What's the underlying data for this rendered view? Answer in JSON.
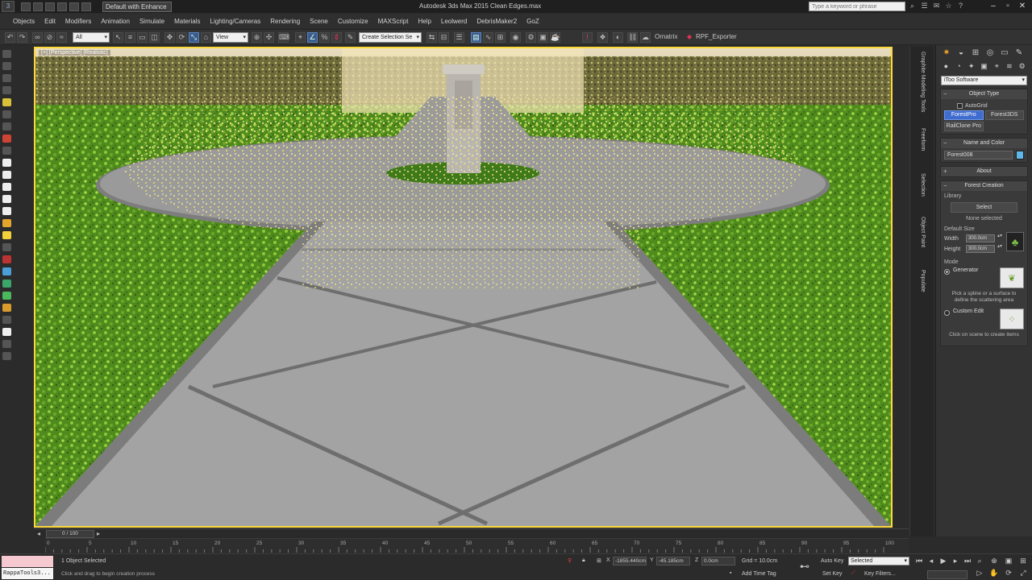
{
  "titlebar": {
    "app_button": "3",
    "workspace": "Default with Enhance",
    "title": "Autodesk 3ds Max 2015    Clean Edges.max",
    "search_placeholder": "Type a keyword or phrase"
  },
  "menu": [
    "Objects",
    "Edit",
    "Modifiers",
    "Animation",
    "Simulate",
    "Materials",
    "Lighting/Cameras",
    "Rendering",
    "Scene",
    "Customize",
    "MAXScript",
    "Help",
    "Leolwerd",
    "DebrisMaker2",
    "GoZ"
  ],
  "toolbar": {
    "selection_filter": "All",
    "ref_coord": "View",
    "named_selection": "Create Selection Se",
    "buttons": [
      "Ornatrix",
      "RPF_Exporter"
    ]
  },
  "viewport": {
    "label": "[+] [Perspective] [Realistic]",
    "border_color": "#fcd93a"
  },
  "tabs": [
    "Graphite Modeling Tools",
    "Freeform",
    "Selection",
    "Object Paint",
    "Populate"
  ],
  "command_panel": {
    "category": "iToo Software",
    "object_type": {
      "title": "Object Type",
      "autogrid": "AutoGrid",
      "buttons": [
        "ForestPro",
        "Forest3DS",
        "RailClone Pro"
      ],
      "active": "ForestPro"
    },
    "name_color": {
      "title": "Name and Color",
      "name": "Forest008",
      "color": "#5fb6e8"
    },
    "about": "About",
    "forest_creation": {
      "title": "Forest Creation",
      "library_label": "Library",
      "select_button": "Select",
      "none_selected": "None selected",
      "default_size": "Default Size",
      "width_label": "Width",
      "width_value": "300.0cm",
      "height_label": "Height",
      "height_value": "300.0cm",
      "mode_label": "Mode",
      "generator": "Generator",
      "generator_desc": "Pick a spline or a surface to define the scattering area",
      "custom_edit": "Custom Edit",
      "custom_desc": "Click on scene to create items"
    }
  },
  "timeline": {
    "slider": "0 / 100",
    "ticks": [
      "0",
      "5",
      "10",
      "15",
      "20",
      "25",
      "30",
      "35",
      "40",
      "45",
      "50",
      "55",
      "60",
      "65",
      "70",
      "75",
      "80",
      "85",
      "90",
      "95",
      "100"
    ]
  },
  "status": {
    "maxscript": "RappaTools3...",
    "objects_selected": "1 Object Selected",
    "prompt": "Click and drag to begin creation process",
    "x_label": "X",
    "x_value": "-1855.440cm",
    "y_label": "Y",
    "y_value": "-45.185cm",
    "z_label": "Z",
    "z_value": "0.0cm",
    "grid": "Grid = 10.0cm",
    "add_time_tag": "Add Time Tag",
    "auto_key": "Auto Key",
    "set_key": "Set Key",
    "key_mode": "Selected",
    "key_filters": "Key Filters..."
  }
}
